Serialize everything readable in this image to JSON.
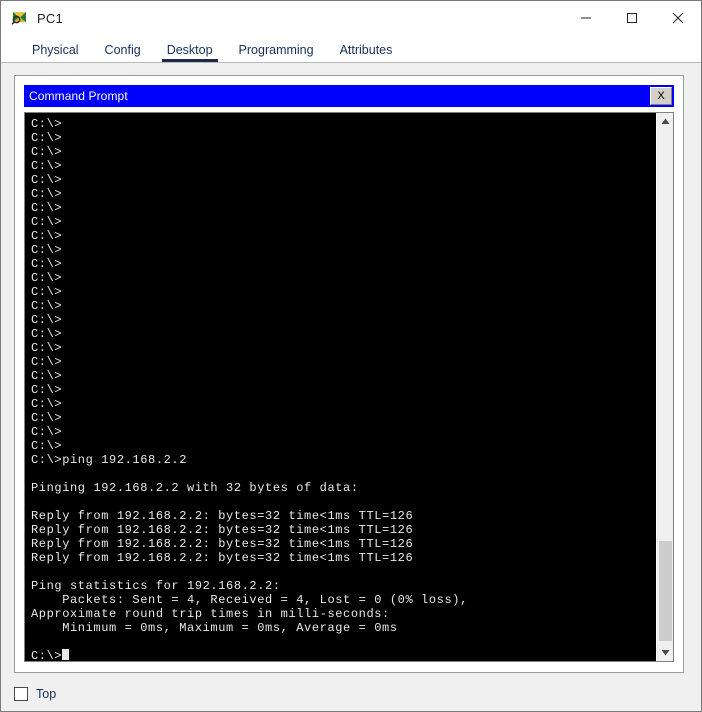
{
  "window": {
    "title": "PC1",
    "icon": "packet-tracer-device-icon",
    "controls": {
      "minimize": "—",
      "maximize": "□",
      "close": "✕"
    }
  },
  "tabs": [
    {
      "label": "Physical",
      "active": false
    },
    {
      "label": "Config",
      "active": false
    },
    {
      "label": "Desktop",
      "active": true
    },
    {
      "label": "Programming",
      "active": false
    },
    {
      "label": "Attributes",
      "active": false
    }
  ],
  "command_prompt": {
    "title": "Command Prompt",
    "close_label": "X",
    "lines": [
      "C:\\>",
      "C:\\>",
      "C:\\>",
      "C:\\>",
      "C:\\>",
      "C:\\>",
      "C:\\>",
      "C:\\>",
      "C:\\>",
      "C:\\>",
      "C:\\>",
      "C:\\>",
      "C:\\>",
      "C:\\>",
      "C:\\>",
      "C:\\>",
      "C:\\>",
      "C:\\>",
      "C:\\>",
      "C:\\>",
      "C:\\>",
      "C:\\>",
      "C:\\>",
      "C:\\>",
      "C:\\>ping 192.168.2.2",
      "",
      "Pinging 192.168.2.2 with 32 bytes of data:",
      "",
      "Reply from 192.168.2.2: bytes=32 time<1ms TTL=126",
      "Reply from 192.168.2.2: bytes=32 time<1ms TTL=126",
      "Reply from 192.168.2.2: bytes=32 time<1ms TTL=126",
      "Reply from 192.168.2.2: bytes=32 time<1ms TTL=126",
      "",
      "Ping statistics for 192.168.2.2:",
      "    Packets: Sent = 4, Received = 4, Lost = 0 (0% loss),",
      "Approximate round trip times in milli-seconds:",
      "    Minimum = 0ms, Maximum = 0ms, Average = 0ms",
      ""
    ],
    "prompt_with_cursor": "C:\\>",
    "scrollbar": {
      "up_arrow": "▲",
      "down_arrow": "▼"
    }
  },
  "footer": {
    "top_checkbox_label": "Top",
    "top_checkbox_checked": false
  },
  "colors": {
    "cmd_titlebar": "#0000ff",
    "terminal_bg": "#000000",
    "terminal_fg": "#e8e8e8",
    "tab_active_underline": "#1b2a4a",
    "panel_bg": "#f0f0f0"
  }
}
